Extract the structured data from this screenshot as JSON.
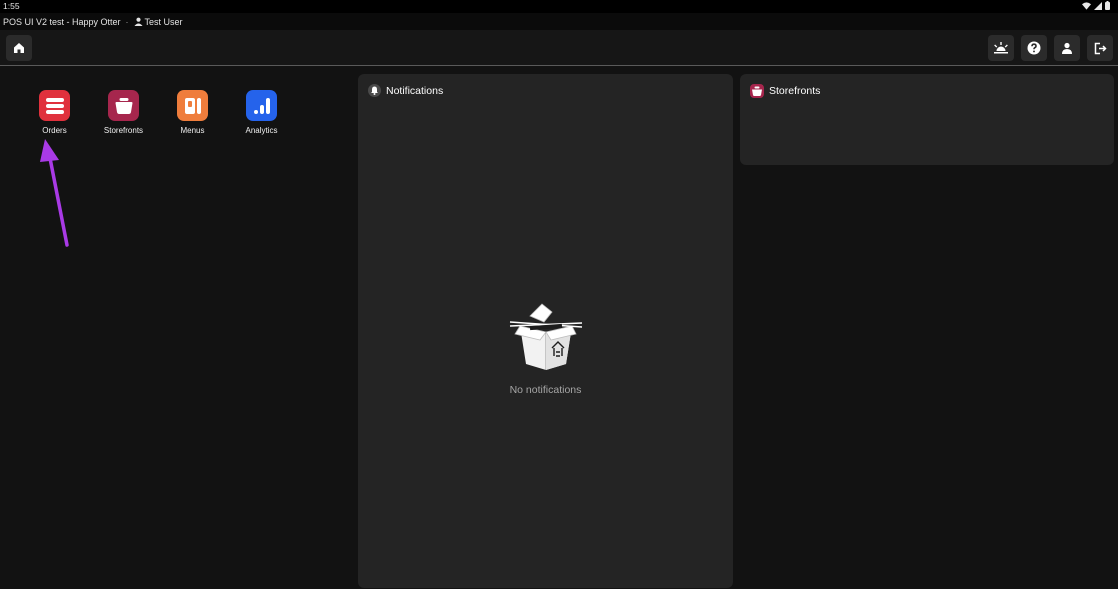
{
  "status_bar": {
    "time": "1:55"
  },
  "title_line": {
    "app_title": "POS UI V2 test - Happy Otter",
    "separator": "·",
    "user_name": "Test User"
  },
  "toolbar": {
    "home_icon": "home-icon",
    "right_icons": [
      "sunrise-icon",
      "help-icon",
      "account-icon",
      "logout-icon"
    ]
  },
  "apps": [
    {
      "label": "Orders",
      "icon": "orders-icon",
      "color": "#e0313d"
    },
    {
      "label": "Storefronts",
      "icon": "storefronts-icon",
      "color": "#a6264d"
    },
    {
      "label": "Menus",
      "icon": "menus-icon",
      "color": "#ef7d3c"
    },
    {
      "label": "Analytics",
      "icon": "analytics-icon",
      "color": "#2563eb"
    }
  ],
  "notifications": {
    "title": "Notifications",
    "empty_text": "No notifications"
  },
  "storefronts_panel": {
    "title": "Storefronts"
  },
  "colors": {
    "background": "#121212",
    "panel": "#242424",
    "annotation_arrow": "#a93ae6"
  }
}
